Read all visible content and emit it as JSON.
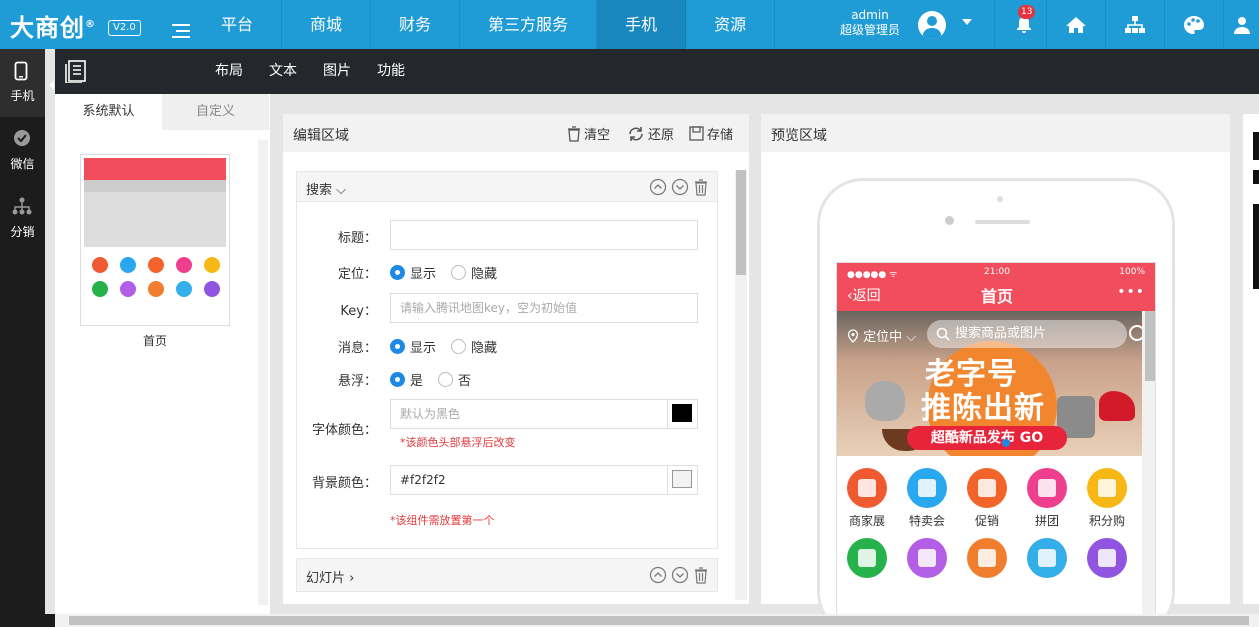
{
  "topbar": {
    "logo": "大商创",
    "logo_mark": "®",
    "version": "V2.0",
    "nav": [
      "平台",
      "商城",
      "财务",
      "第三方服务",
      "手机",
      "资源"
    ],
    "active_nav": "手机",
    "admin_name": "admin",
    "admin_role": "超级管理员",
    "notification_count": "13"
  },
  "sidebar": {
    "items": [
      {
        "label": "手机",
        "icon": "phone-icon"
      },
      {
        "label": "微信",
        "icon": "wechat-icon"
      },
      {
        "label": "分销",
        "icon": "network-icon"
      }
    ]
  },
  "subbar": {
    "items": [
      "布局",
      "文本",
      "图片",
      "功能"
    ]
  },
  "left_panel": {
    "tabs": [
      "系统默认",
      "自定义"
    ],
    "template_label": "首页"
  },
  "editor": {
    "title": "编辑区域",
    "clear_label": "清空",
    "restore_label": "还原",
    "save_label": "存储",
    "search_block": {
      "title": "搜索",
      "title_label": "标题：",
      "title_value": "",
      "location_label": "定位：",
      "location_options": [
        "显示",
        "隐藏"
      ],
      "location_selected": "显示",
      "key_label": "Key：",
      "key_placeholder": "请输入腾讯地图key，空为初始值",
      "message_label": "消息：",
      "message_options": [
        "显示",
        "隐藏"
      ],
      "message_selected": "显示",
      "float_label": "悬浮：",
      "float_options": [
        "是",
        "否"
      ],
      "float_selected": "是",
      "font_color_label": "字体颜色：",
      "font_color_placeholder": "默认为黑色",
      "font_color_swatch": "#000000",
      "font_color_hint": "*该颜色头部悬浮后改变",
      "bg_color_label": "背景颜色：",
      "bg_color_value": "#f2f2f2",
      "bg_color_swatch": "#f2f2f2",
      "bg_hint": "*该组件需放置第一个"
    },
    "slideshow_block": {
      "title": "幻灯片"
    }
  },
  "preview": {
    "title": "预览区域",
    "status_left": "●●●●● ᯤ",
    "status_time": "21:00",
    "status_right": "100%",
    "back_label": "返回",
    "page_title": "首页",
    "more": "•••",
    "location": "定位中",
    "search_placeholder": "搜索商品或图片",
    "banner_line1": "老字号",
    "banner_line2": "推陈出新",
    "banner_pill": "超酷新品发布 GO",
    "icons": [
      {
        "label": "商家展",
        "color": "#f05a33"
      },
      {
        "label": "特卖会",
        "color": "#29a8f0"
      },
      {
        "label": "促销",
        "color": "#f2642a"
      },
      {
        "label": "拼团",
        "color": "#ee3f8e"
      },
      {
        "label": "积分购",
        "color": "#f6b814"
      },
      {
        "label": "",
        "color": "#25b24a"
      },
      {
        "label": "",
        "color": "#b35ee6"
      },
      {
        "label": "",
        "color": "#f07e2e"
      },
      {
        "label": "",
        "color": "#33aee9"
      },
      {
        "label": "",
        "color": "#8f55e0"
      }
    ]
  },
  "colors": {
    "topbar": "#1f9bd5",
    "sidebar": "#1c1c1c",
    "subbar": "#24272c",
    "phone_header": "#f24d5d",
    "radio_active": "#1e88e5"
  }
}
